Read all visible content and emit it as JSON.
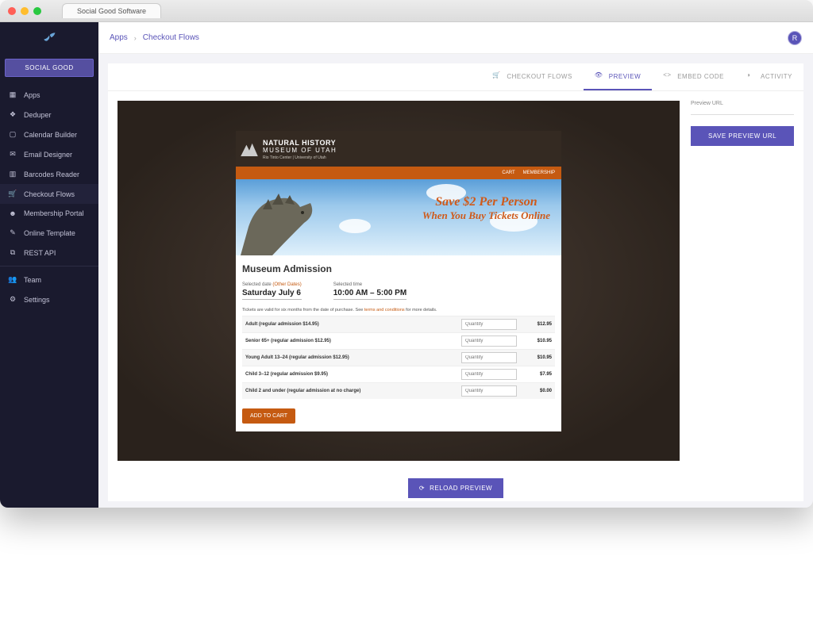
{
  "window": {
    "tab_title": "Social Good Software"
  },
  "brand_button": "SOCIAL GOOD",
  "sidebar": {
    "items": [
      {
        "label": "Apps"
      },
      {
        "label": "Deduper"
      },
      {
        "label": "Calendar Builder"
      },
      {
        "label": "Email Designer"
      },
      {
        "label": "Barcodes Reader"
      },
      {
        "label": "Checkout Flows"
      },
      {
        "label": "Membership Portal"
      },
      {
        "label": "Online Template"
      },
      {
        "label": "REST API"
      },
      {
        "label": "Team"
      },
      {
        "label": "Settings"
      }
    ]
  },
  "breadcrumb": {
    "item0": "Apps",
    "item1": "Checkout Flows"
  },
  "avatar_initial": "R",
  "tabs": {
    "checkout_flows": "CHECKOUT FLOWS",
    "preview": "PREVIEW",
    "embed_code": "EMBED CODE",
    "activity": "ACTIVITY"
  },
  "preview_side": {
    "label": "Preview URL",
    "save_btn": "SAVE PREVIEW URL"
  },
  "reload_btn": "RELOAD PREVIEW",
  "museum": {
    "brand_line1": "NATURAL HISTORY",
    "brand_line2": "MUSEUM OF UTAH",
    "brand_line3": "Rio Tinto Center | University of Utah",
    "nav": {
      "cart": "CART",
      "membership": "MEMBERSHIP"
    },
    "banner": {
      "line1": "Save $2 Per Person",
      "line2": "When You Buy Tickets Online"
    },
    "page_title": "Museum Admission",
    "selected_date_label": "Selected date",
    "other_dates": "(Other Dates)",
    "selected_date_value": "Saturday July 6",
    "selected_time_label": "Selected time",
    "selected_time_value": "10:00 AM – 5:00 PM",
    "validity_pre": "Tickets are valid for six months from the date of purchase. See ",
    "validity_link": "terms and conditions",
    "validity_post": " for more details.",
    "qty_placeholder": "Quantity",
    "tickets": [
      {
        "name": "Adult (regular admission $14.95)",
        "price": "$12.95"
      },
      {
        "name": "Senior 65+ (regular admission $12.95)",
        "price": "$10.95"
      },
      {
        "name": "Young Adult 13–24 (regular admission $12.95)",
        "price": "$10.95"
      },
      {
        "name": "Child 3–12 (regular admission $9.95)",
        "price": "$7.95"
      },
      {
        "name": "Child 2 and under (regular admission at no charge)",
        "price": "$0.00"
      }
    ],
    "add_cart": "ADD TO CART"
  }
}
